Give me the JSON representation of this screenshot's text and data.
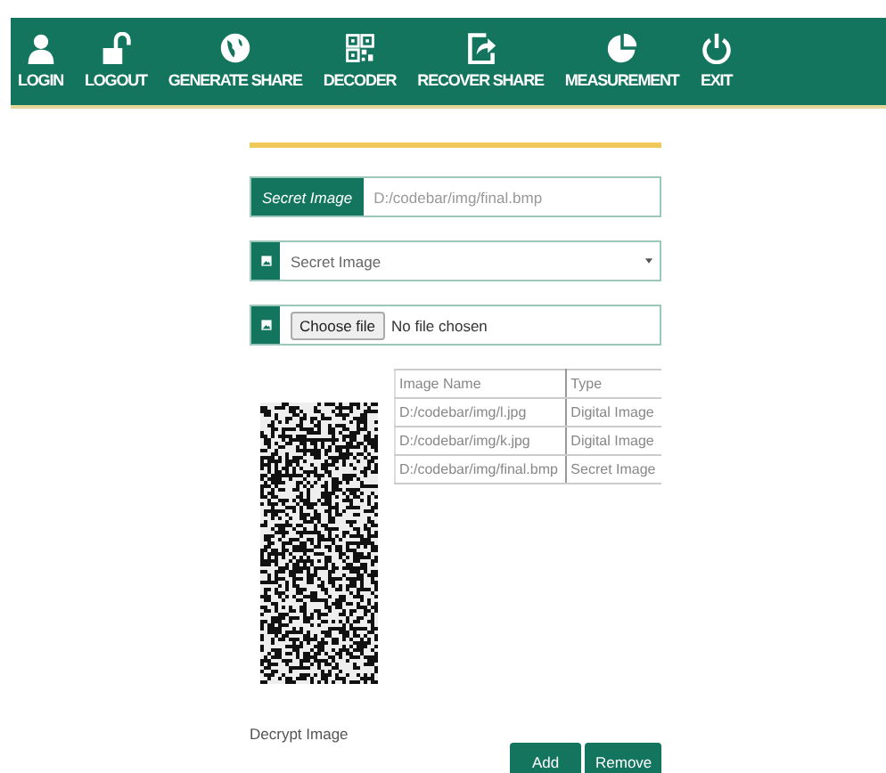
{
  "nav": [
    {
      "label": "LOGIN"
    },
    {
      "label": "LOGOUT"
    },
    {
      "label": "GENERATE SHARE"
    },
    {
      "label": "DECODER"
    },
    {
      "label": "RECOVER SHARE"
    },
    {
      "label": "MEASUREMENT"
    },
    {
      "label": "EXIT"
    }
  ],
  "secret_field": {
    "label": "Secret Image",
    "value": "D:/codebar/img/final.bmp"
  },
  "select": {
    "value": "Secret Image"
  },
  "file": {
    "button": "Choose file",
    "status": "No file chosen"
  },
  "table": {
    "columns": [
      "Image Name",
      "Type"
    ],
    "rows": [
      [
        "D:/codebar/img/l.jpg",
        "Digital Image"
      ],
      [
        "D:/codebar/img/k.jpg",
        "Digital Image"
      ],
      [
        "D:/codebar/img/final.bmp",
        "Secret Image"
      ]
    ]
  },
  "decrypt_label": "Decrypt Image",
  "buttons": [
    "Add",
    "Remove"
  ]
}
